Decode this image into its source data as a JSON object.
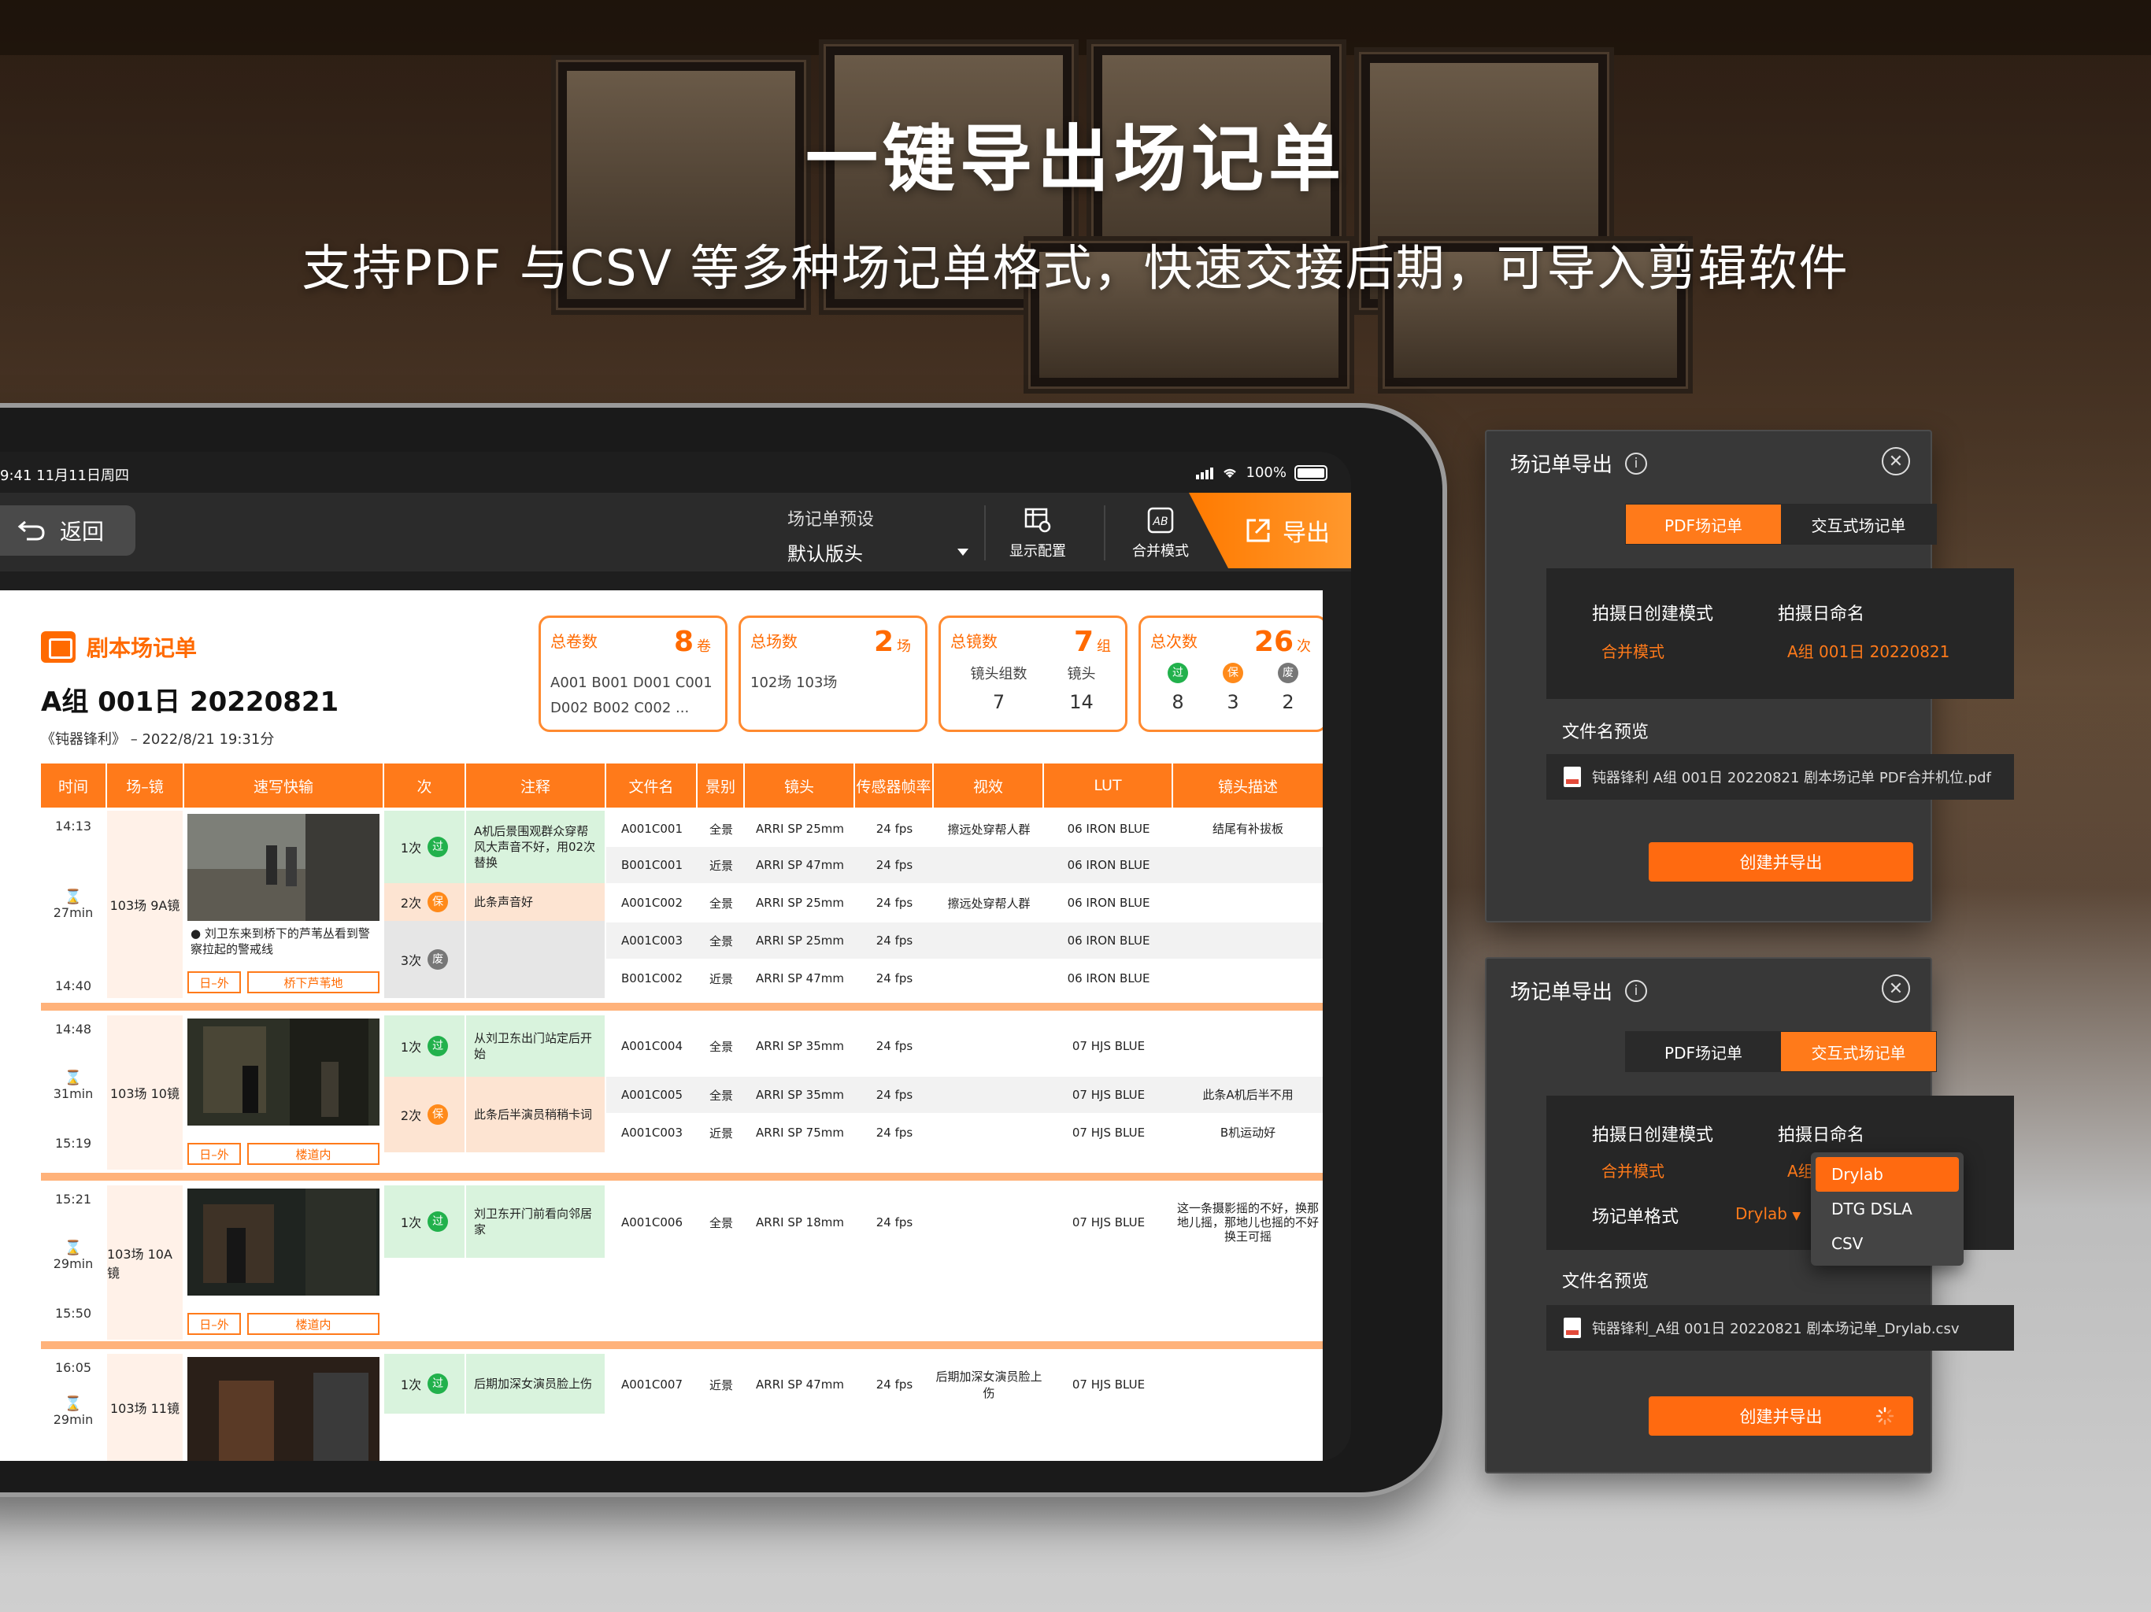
{
  "headline": "一键导出场记单",
  "subline": "支持PDF 与CSV 等多种场记单格式，快速交接后期，可导入剪辑软件",
  "status": {
    "time": "9:41  11月11日周四",
    "battery": "100%"
  },
  "toolbar": {
    "back": "返回",
    "preset_label": "场记单预设",
    "preset_value": "默认版头",
    "display_config": "显示配置",
    "merge_mode": "合并模式",
    "export": "导出"
  },
  "doc": {
    "tag": "剧本场记单",
    "title": "A组 001日 20220821",
    "meta": "《钝器锋利》 – 2022/8/21 19:31分"
  },
  "stats": {
    "rolls": {
      "name": "总卷数",
      "num": "8",
      "unit": "卷",
      "line1": "A001   B001   D001   C001",
      "line2": "D002   B002   C002   ..."
    },
    "scenes": {
      "name": "总场数",
      "num": "2",
      "unit": "场",
      "line1": "102场    103场"
    },
    "shots": {
      "name": "总镜数",
      "num": "7",
      "unit": "组",
      "col1_label": "镜头组数",
      "col1_value": "7",
      "col2_label": "镜头",
      "col2_value": "14"
    },
    "takes": {
      "name": "总次数",
      "num": "26",
      "unit": "次",
      "pass": "过",
      "keep": "保",
      "ng": "废",
      "pass_n": "8",
      "keep_n": "3",
      "ng_n": "2"
    }
  },
  "columns": [
    "时间",
    "场–镜",
    "速写快输",
    "次",
    "注释",
    "文件名",
    "景别",
    "镜头",
    "传感器帧率",
    "视效",
    "LUT",
    "镜头描述"
  ],
  "groups": [
    {
      "start": "14:13",
      "dur": "27min",
      "end": "14:40",
      "scene": "103场   9A镜",
      "note": "● 刘卫东来到桥下的芦苇丛看到警察拉起的警戒线",
      "tag1": "日–外",
      "tag2": "桥下芦苇地",
      "takes": [
        {
          "label": "1次",
          "badge": "过",
          "note": "A机后景围观群众穿帮 风大声音不好，用02次替换"
        },
        {
          "label": "2次",
          "badge": "保",
          "note": "此条声音好"
        },
        {
          "label": "3次",
          "badge": "废",
          "note": ""
        }
      ],
      "rows": [
        {
          "file": "A001C001",
          "view": "全景",
          "lens": "ARRI SP 25mm",
          "fps": "24 fps",
          "vfx": "擦远处穿帮人群",
          "lut": "06 IRON BLUE",
          "desc": "结尾有补拔板"
        },
        {
          "file": "B001C001",
          "view": "近景",
          "lens": "ARRI SP 47mm",
          "fps": "24 fps",
          "vfx": "",
          "lut": "06 IRON BLUE",
          "desc": ""
        },
        {
          "file": "A001C002",
          "view": "全景",
          "lens": "ARRI SP 25mm",
          "fps": "24 fps",
          "vfx": "擦远处穿帮人群",
          "lut": "06 IRON BLUE",
          "desc": ""
        },
        {
          "file": "A001C003",
          "view": "全景",
          "lens": "ARRI SP 25mm",
          "fps": "24 fps",
          "vfx": "",
          "lut": "06 IRON BLUE",
          "desc": ""
        },
        {
          "file": "B001C002",
          "view": "近景",
          "lens": "ARRI SP 47mm",
          "fps": "24 fps",
          "vfx": "",
          "lut": "06 IRON BLUE",
          "desc": ""
        }
      ]
    },
    {
      "start": "14:48",
      "dur": "31min",
      "end": "15:19",
      "scene": "103场   10镜",
      "tag1": "日–外",
      "tag2": "楼道内",
      "takes": [
        {
          "label": "1次",
          "badge": "过",
          "note": "从刘卫东出门站定后开始"
        },
        {
          "label": "2次",
          "badge": "保",
          "note": "此条后半演员稍稍卡词"
        }
      ],
      "rows": [
        {
          "file": "A001C004",
          "view": "全景",
          "lens": "ARRI SP 35mm",
          "fps": "24 fps",
          "vfx": "",
          "lut": "07 HJS BLUE",
          "desc": ""
        },
        {
          "file": "A001C005",
          "view": "全景",
          "lens": "ARRI SP 35mm",
          "fps": "24 fps",
          "vfx": "",
          "lut": "07 HJS BLUE",
          "desc": "此条A机后半不用"
        },
        {
          "file": "A001C003",
          "view": "近景",
          "lens": "ARRI SP 75mm",
          "fps": "24 fps",
          "vfx": "",
          "lut": "07 HJS BLUE",
          "desc": "B机运动好"
        }
      ]
    },
    {
      "start": "15:21",
      "dur": "29min",
      "end": "15:50",
      "scene": "103场   10A镜",
      "tag1": "日–外",
      "tag2": "楼道内",
      "takes": [
        {
          "label": "1次",
          "badge": "过",
          "note": "刘卫东开门前看向邻居家"
        }
      ],
      "rows": [
        {
          "file": "A001C006",
          "view": "全景",
          "lens": "ARRI SP 18mm",
          "fps": "24 fps",
          "vfx": "",
          "lut": "07 HJS BLUE",
          "desc": "这一条摄影摇的不好，换那地儿摇，那地儿也摇的不好换王可摇"
        }
      ]
    },
    {
      "start": "16:05",
      "dur": "29min",
      "scene": "103场   11镜",
      "takes": [
        {
          "label": "1次",
          "badge": "过",
          "note": "后期加深女演员脸上伤"
        }
      ],
      "rows": [
        {
          "file": "A001C007",
          "view": "近景",
          "lens": "ARRI SP 47mm",
          "fps": "24 fps",
          "vfx": "后期加深女演员脸上伤",
          "lut": "07 HJS BLUE",
          "desc": ""
        }
      ]
    }
  ],
  "panel1": {
    "title": "场记单导出",
    "tab_pdf": "PDF场记单",
    "tab_interactive": "交互式场记单",
    "mode_label": "拍摄日创建模式",
    "mode_value": "合并模式",
    "naming_label": "拍摄日命名",
    "naming_value": "A组 001日 20220821",
    "preview_label": "文件名预览",
    "preview_value": "钝器锋利 A组 001日 20220821 剧本场记单 PDF合并机位.pdf",
    "cta": "创建并导出"
  },
  "panel2": {
    "title": "场记单导出",
    "tab_pdf": "PDF场记单",
    "tab_interactive": "交互式场记单",
    "mode_label": "拍摄日创建模式",
    "mode_value": "合并模式",
    "naming_label": "拍摄日命名",
    "naming_value": "A组 001",
    "format_label": "场记单格式",
    "format_value": "Drylab",
    "options": [
      "Drylab",
      "DTG DSLA",
      "CSV"
    ],
    "preview_label": "文件名预览",
    "preview_value": "钝器锋利_A组 001日 20220821 剧本场记单_Drylab.csv",
    "cta": "创建并导出"
  },
  "colors": {
    "accent": "#ff7a1a",
    "pass": "#22b14c",
    "keep": "#ff8a1a",
    "ng": "#777777"
  }
}
